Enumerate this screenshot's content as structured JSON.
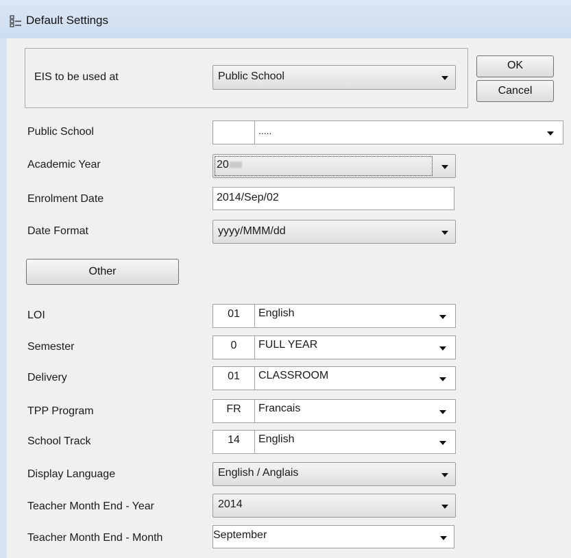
{
  "window": {
    "title": "Default Settings",
    "icon": "window-app-icon"
  },
  "buttons": {
    "ok": "OK",
    "cancel": "Cancel",
    "other": "Other"
  },
  "eis": {
    "label": "EIS to be used at",
    "value": "Public School"
  },
  "public_school": {
    "label": "Public School",
    "code": "",
    "value": "....."
  },
  "academic_year": {
    "label": "Academic Year",
    "value": "20"
  },
  "enrolment_date": {
    "label": "Enrolment Date",
    "value": "2014/Sep/02"
  },
  "date_format": {
    "label": "Date Format",
    "value": "yyyy/MMM/dd"
  },
  "loi": {
    "label": "LOI",
    "code": "01",
    "value": "English"
  },
  "semester": {
    "label": "Semester",
    "code": "0",
    "value": "FULL YEAR"
  },
  "delivery": {
    "label": "Delivery",
    "code": "01",
    "value": "CLASSROOM"
  },
  "tpp_program": {
    "label": "TPP Program",
    "code": "FR",
    "value": "Francais"
  },
  "school_track": {
    "label": "School Track",
    "code": "14",
    "value": "English"
  },
  "display_language": {
    "label": "Display Language",
    "value": "English / Anglais"
  },
  "teacher_month_end_year": {
    "label": "Teacher Month End - Year",
    "value": "2014"
  },
  "teacher_month_end_month": {
    "label": "Teacher Month End - Month",
    "value": "September"
  }
}
